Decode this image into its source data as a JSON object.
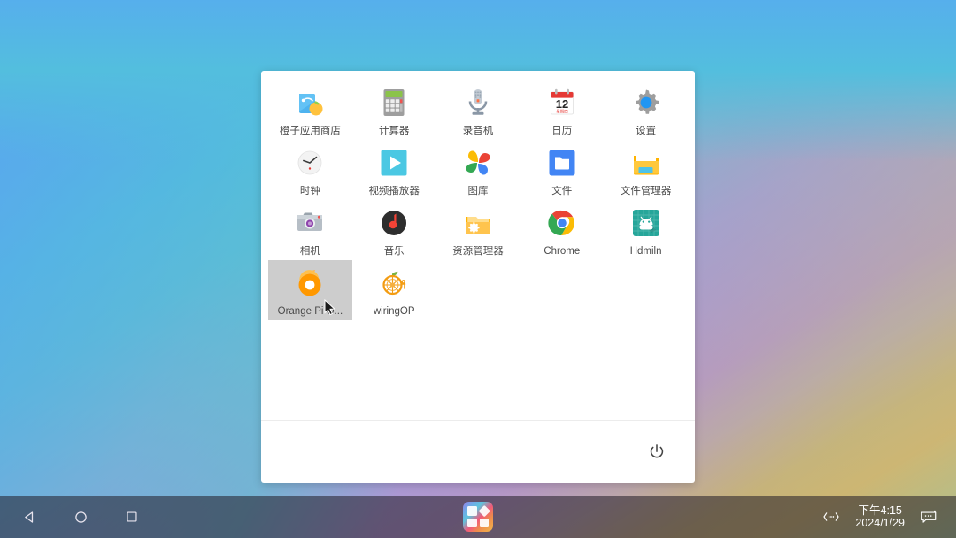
{
  "desktop": {
    "wallpaper_colors": {
      "top_left": "#5aa2ef",
      "top_right": "#4cc9cc",
      "bottom_left": "#b08ad8",
      "bottom_mid": "#e8a85e",
      "bottom_right": "#a8bf93"
    }
  },
  "launcher": {
    "panel_bg": "#ffffff",
    "selected_bg": "#cdcdcd",
    "power_label": "power-button",
    "apps": [
      {
        "label": "橙子应用商店",
        "icon": "orange-app-store-icon",
        "selected": false
      },
      {
        "label": "计算器",
        "icon": "calculator-icon",
        "selected": false
      },
      {
        "label": "录音机",
        "icon": "sound-recorder-icon",
        "selected": false
      },
      {
        "label": "日历",
        "icon": "calendar-icon",
        "selected": false
      },
      {
        "label": "设置",
        "icon": "settings-gear-icon",
        "selected": false
      },
      {
        "label": "时钟",
        "icon": "clock-icon",
        "selected": false
      },
      {
        "label": "视频播放器",
        "icon": "video-player-icon",
        "selected": false
      },
      {
        "label": "图库",
        "icon": "gallery-photos-icon",
        "selected": false
      },
      {
        "label": "文件",
        "icon": "files-folder-icon",
        "selected": false
      },
      {
        "label": "文件管理器",
        "icon": "file-manager-icon",
        "selected": false
      },
      {
        "label": "相机",
        "icon": "camera-icon",
        "selected": false
      },
      {
        "label": "音乐",
        "icon": "music-icon",
        "selected": false
      },
      {
        "label": "资源管理器",
        "icon": "resource-manager-icon",
        "selected": false
      },
      {
        "label": "Chrome",
        "icon": "chrome-icon",
        "selected": false
      },
      {
        "label": "Hdmiln",
        "icon": "hdmiln-android-icon",
        "selected": false
      },
      {
        "label": "Orange Pi O...",
        "icon": "orange-pi-os-icon",
        "selected": true
      },
      {
        "label": "wiringOP",
        "icon": "wiringop-icon",
        "selected": false
      }
    ],
    "calendar_icon": {
      "day_number": "12",
      "weekday": "星期四"
    }
  },
  "taskbar": {
    "nav": [
      {
        "name": "back-button",
        "glyph": "back-triangle-icon"
      },
      {
        "name": "home-button",
        "glyph": "home-circle-icon"
      },
      {
        "name": "recents-button",
        "glyph": "recents-square-icon"
      }
    ],
    "app_drawer_label": "app-drawer-button",
    "status": {
      "network_icon": "ethernet-network-icon",
      "time": "下午4:15",
      "date": "2024/1/29",
      "notification_icon": "keyboard-input-icon"
    }
  }
}
